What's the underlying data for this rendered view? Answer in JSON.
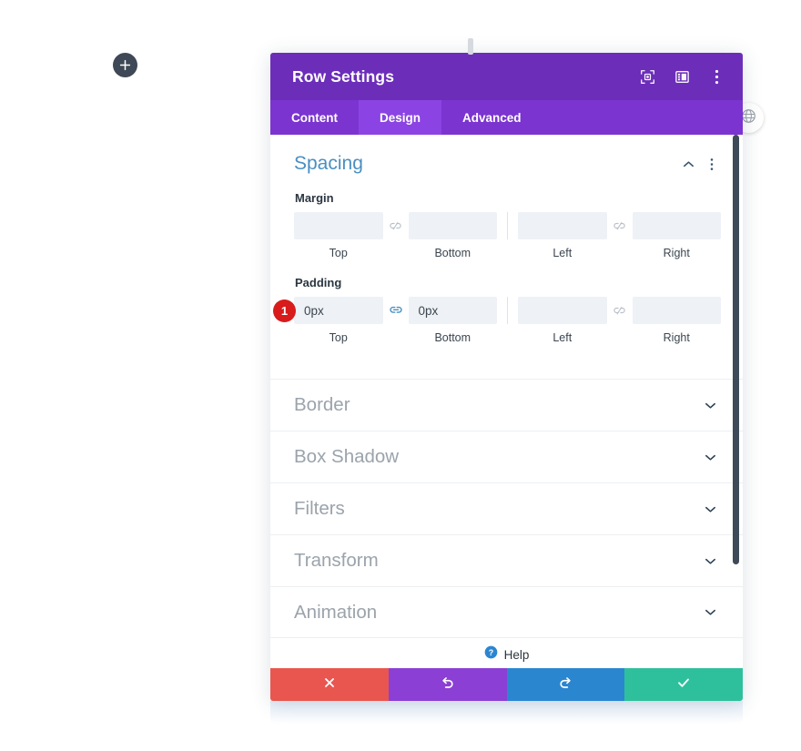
{
  "canvas": {
    "add_button_icon": "plus-icon",
    "globe_button_icon": "globe-icon",
    "drag_handle": "drag-handle"
  },
  "modal": {
    "title": "Row Settings",
    "header_icons": [
      {
        "name": "focus-target-icon",
        "label": "Focus"
      },
      {
        "name": "layout-columns-icon",
        "label": "Layout"
      },
      {
        "name": "more-vertical-icon",
        "label": "More options"
      }
    ],
    "tabs": [
      {
        "label": "Content",
        "active": false
      },
      {
        "label": "Design",
        "active": true
      },
      {
        "label": "Advanced",
        "active": false
      }
    ],
    "open_section": {
      "title": "Spacing",
      "collapse_icon": "chevron-up-icon",
      "more_icon": "more-vertical-icon",
      "groups": [
        {
          "label": "Margin",
          "badge": null,
          "link_left": {
            "icon": "link-broken-icon",
            "linked": false
          },
          "link_right": {
            "icon": "link-broken-icon",
            "linked": false
          },
          "fields": [
            {
              "value": "",
              "placeholder": "",
              "caption": "Top"
            },
            {
              "value": "",
              "placeholder": "",
              "caption": "Bottom"
            },
            {
              "value": "",
              "placeholder": "",
              "caption": "Left"
            },
            {
              "value": "",
              "placeholder": "",
              "caption": "Right"
            }
          ]
        },
        {
          "label": "Padding",
          "badge": "1",
          "link_left": {
            "icon": "link-connected-icon",
            "linked": true
          },
          "link_right": {
            "icon": "link-broken-icon",
            "linked": false
          },
          "fields": [
            {
              "value": "0px",
              "placeholder": "",
              "caption": "Top"
            },
            {
              "value": "0px",
              "placeholder": "",
              "caption": "Bottom"
            },
            {
              "value": "",
              "placeholder": "",
              "caption": "Left"
            },
            {
              "value": "",
              "placeholder": "",
              "caption": "Right"
            }
          ]
        }
      ]
    },
    "collapsed_sections": [
      {
        "title": "Border",
        "icon": "chevron-down-icon"
      },
      {
        "title": "Box Shadow",
        "icon": "chevron-down-icon"
      },
      {
        "title": "Filters",
        "icon": "chevron-down-icon"
      },
      {
        "title": "Transform",
        "icon": "chevron-down-icon"
      },
      {
        "title": "Animation",
        "icon": "chevron-down-icon"
      }
    ],
    "help": {
      "label": "Help",
      "icon": "help-circle-icon"
    },
    "footer": [
      {
        "name": "cancel-button",
        "icon": "close-x-icon",
        "color": "#e9564f"
      },
      {
        "name": "undo-button",
        "icon": "undo-arrow-icon",
        "color": "#8b3fd4"
      },
      {
        "name": "redo-button",
        "icon": "redo-arrow-icon",
        "color": "#2b86d0"
      },
      {
        "name": "save-button",
        "icon": "checkmark-icon",
        "color": "#2ec09c"
      }
    ]
  },
  "colors": {
    "header_purple": "#6c2eb9",
    "tabbar_purple": "#7b34d0",
    "tab_active_purple": "#8b44e3",
    "section_title_blue": "#4a8fc0",
    "badge_red": "#d81b1b",
    "link_active_blue": "#4a8fc0",
    "scrollbar_dark": "#3e4a58"
  }
}
